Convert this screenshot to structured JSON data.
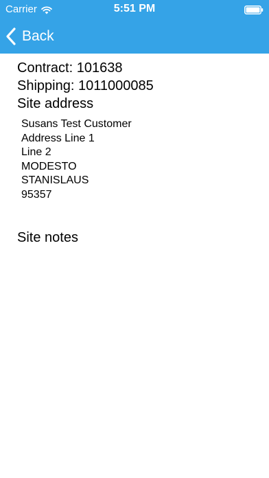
{
  "status_bar": {
    "carrier": "Carrier",
    "time": "5:51 PM",
    "wifi_icon": "wifi-icon",
    "battery_icon": "battery-icon"
  },
  "nav": {
    "back_label": "Back",
    "back_icon": "chevron-left-icon"
  },
  "colors": {
    "header_bg": "#35a3e7",
    "header_text": "#ffffff",
    "body_text": "#000000"
  },
  "details": {
    "contract": "Contract: 101638",
    "shipping": "Shipping: 1011000085",
    "site_address_heading": "Site address",
    "address_lines": [
      "Susans Test Customer",
      "Address Line 1",
      "Line 2",
      "MODESTO",
      "STANISLAUS",
      "95357"
    ],
    "site_notes_heading": "Site notes"
  }
}
